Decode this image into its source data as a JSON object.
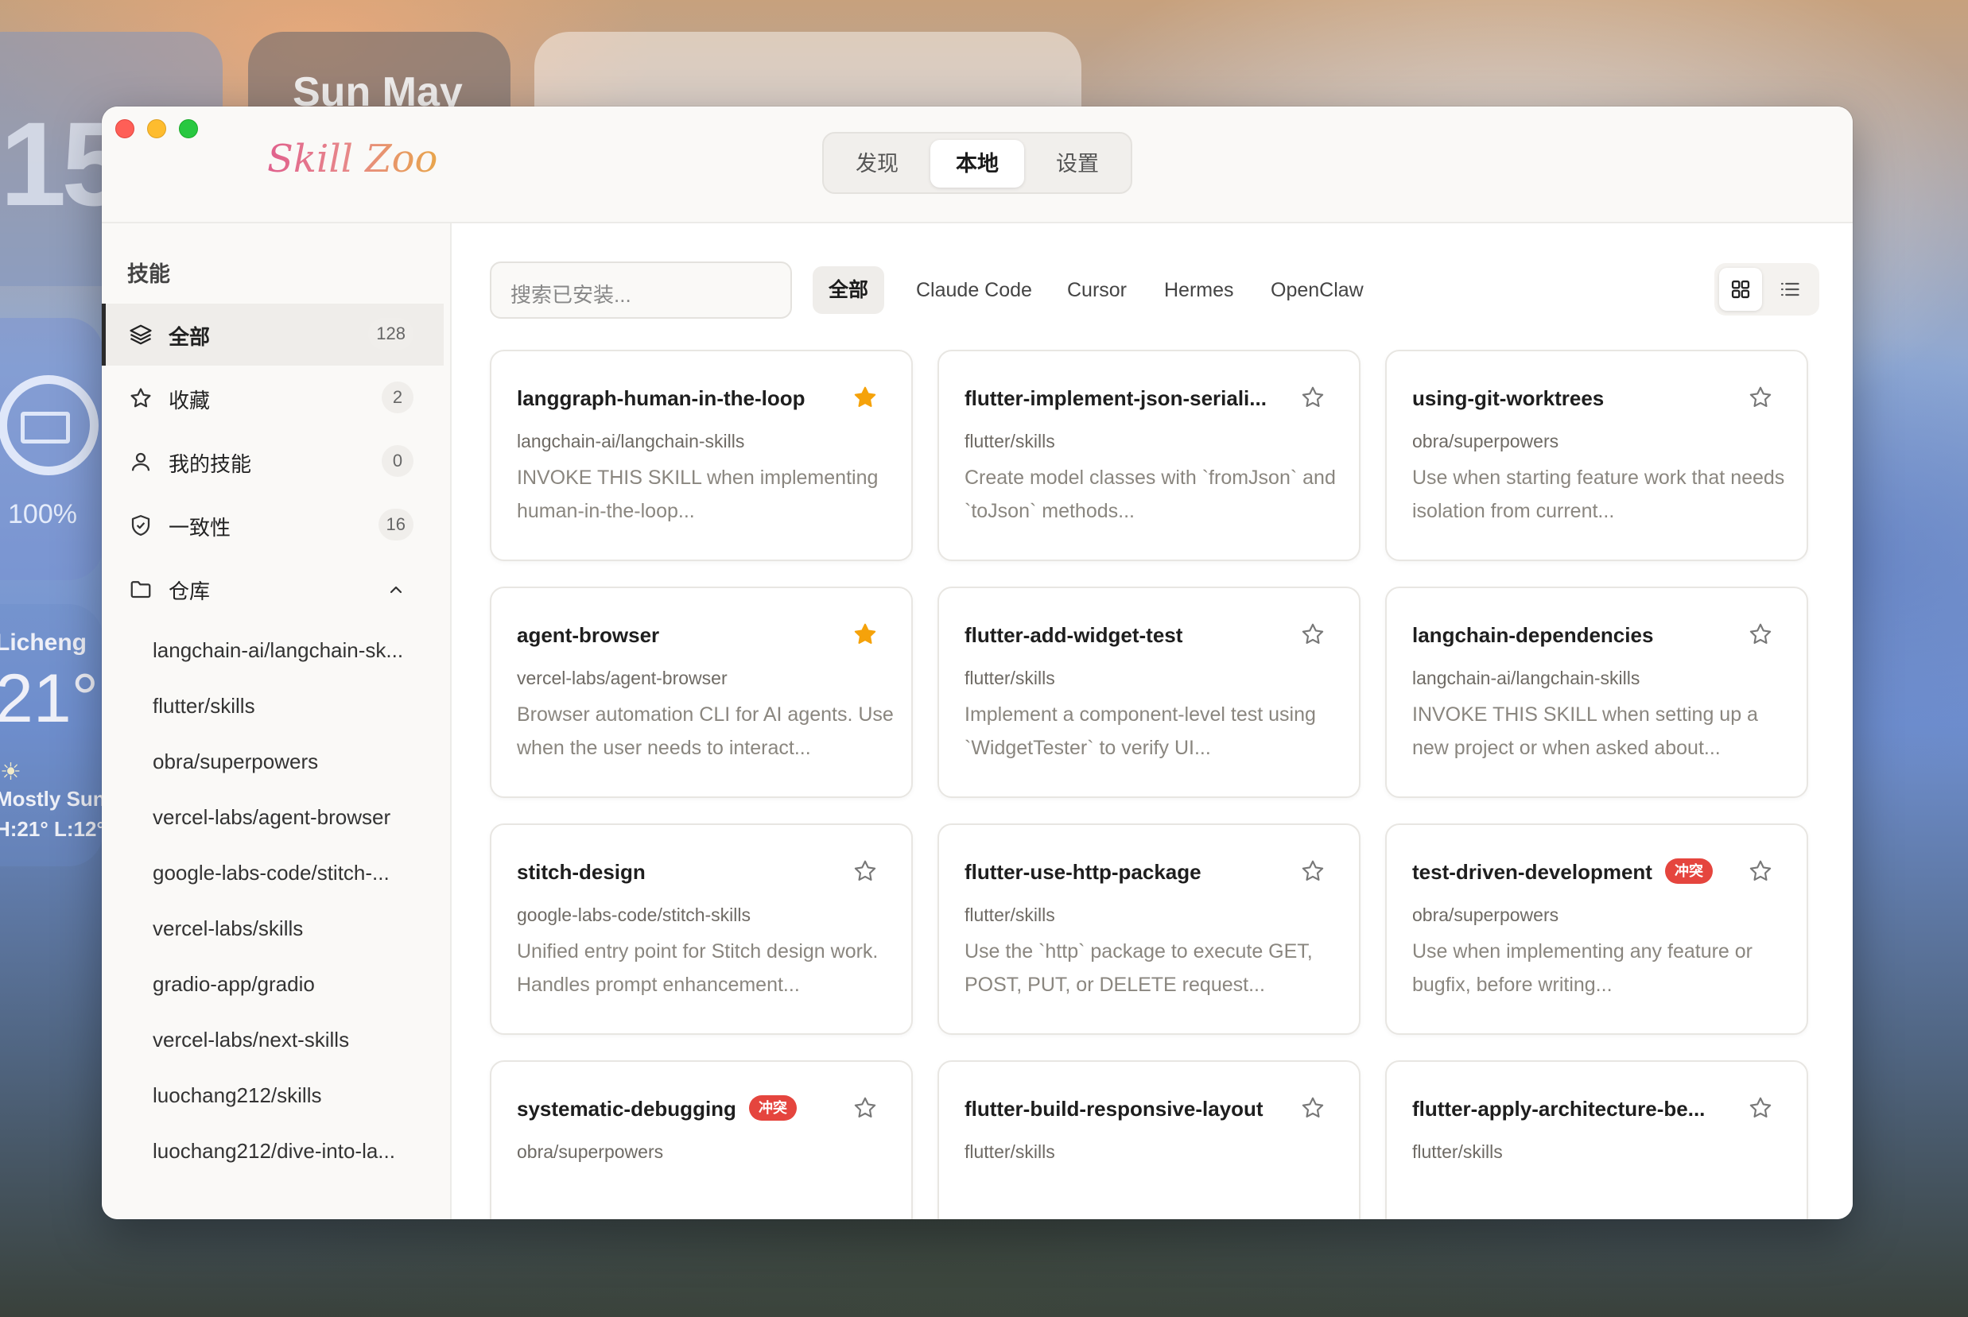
{
  "desktop": {
    "clock_partial": "15:",
    "date_partial": "Sun May",
    "battery_pct": "100%",
    "weather": {
      "city": "Licheng",
      "temp": "21°",
      "condition": "Mostly Sun",
      "high_low": "H:21° L:12°"
    }
  },
  "app": {
    "title": "Skill Zoo",
    "nav_tabs": [
      {
        "label": "发现",
        "active": false
      },
      {
        "label": "本地",
        "active": true
      },
      {
        "label": "设置",
        "active": false
      }
    ]
  },
  "sidebar": {
    "section_title": "技能",
    "items": [
      {
        "label": "全部",
        "count": "128",
        "icon": "layers-icon",
        "active": true
      },
      {
        "label": "收藏",
        "count": "2",
        "icon": "star-icon",
        "active": false
      },
      {
        "label": "我的技能",
        "count": "0",
        "icon": "user-icon",
        "active": false
      },
      {
        "label": "一致性",
        "count": "16",
        "icon": "shield-check-icon",
        "active": false
      },
      {
        "label": "仓库",
        "icon": "folder-icon",
        "expanded": true
      }
    ],
    "repos": [
      "langchain-ai/langchain-sk...",
      "flutter/skills",
      "obra/superpowers",
      "vercel-labs/agent-browser",
      "google-labs-code/stitch-...",
      "vercel-labs/skills",
      "gradio-app/gradio",
      "vercel-labs/next-skills",
      "luochang212/skills",
      "luochang212/dive-into-la..."
    ]
  },
  "toolbar": {
    "search_placeholder": "搜索已安装...",
    "filters": [
      {
        "label": "全部",
        "active": true
      },
      {
        "label": "Claude Code",
        "active": false
      },
      {
        "label": "Cursor",
        "active": false
      },
      {
        "label": "Hermes",
        "active": false
      },
      {
        "label": "OpenClaw",
        "active": false
      }
    ],
    "view_mode": "grid"
  },
  "cards": [
    {
      "title": "langgraph-human-in-the-loop",
      "repo": "langchain-ai/langchain-skills",
      "desc": "INVOKE THIS SKILL when implementing human-in-the-loop...",
      "starred": true,
      "badge": ""
    },
    {
      "title": "flutter-implement-json-seriali...",
      "repo": "flutter/skills",
      "desc": "Create model classes with `fromJson` and `toJson` methods...",
      "starred": false,
      "badge": ""
    },
    {
      "title": "using-git-worktrees",
      "repo": "obra/superpowers",
      "desc": "Use when starting feature work that needs isolation from current...",
      "starred": false,
      "badge": ""
    },
    {
      "title": "agent-browser",
      "repo": "vercel-labs/agent-browser",
      "desc": "Browser automation CLI for AI agents. Use when the user needs to interact...",
      "starred": true,
      "badge": ""
    },
    {
      "title": "flutter-add-widget-test",
      "repo": "flutter/skills",
      "desc": "Implement a component-level test using `WidgetTester` to verify UI...",
      "starred": false,
      "badge": ""
    },
    {
      "title": "langchain-dependencies",
      "repo": "langchain-ai/langchain-skills",
      "desc": "INVOKE THIS SKILL when setting up a new project or when asked about...",
      "starred": false,
      "badge": ""
    },
    {
      "title": "stitch-design",
      "repo": "google-labs-code/stitch-skills",
      "desc": "Unified entry point for Stitch design work. Handles prompt enhancement...",
      "starred": false,
      "badge": ""
    },
    {
      "title": "flutter-use-http-package",
      "repo": "flutter/skills",
      "desc": "Use the `http` package to execute GET, POST, PUT, or DELETE request...",
      "starred": false,
      "badge": ""
    },
    {
      "title": "test-driven-development",
      "repo": "obra/superpowers",
      "desc": "Use when implementing any feature or bugfix, before writing...",
      "starred": false,
      "badge": "冲突"
    },
    {
      "title": "systematic-debugging",
      "repo": "obra/superpowers",
      "desc": "",
      "starred": false,
      "badge": "冲突"
    },
    {
      "title": "flutter-build-responsive-layout",
      "repo": "flutter/skills",
      "desc": "",
      "starred": false,
      "badge": ""
    },
    {
      "title": "flutter-apply-architecture-be...",
      "repo": "flutter/skills",
      "desc": "",
      "starred": false,
      "badge": ""
    }
  ],
  "colors": {
    "star_active": "#f5a20a",
    "badge_conflict": "#e5453e",
    "accent_logo_start": "#e0608d",
    "accent_logo_end": "#e8a54b"
  }
}
